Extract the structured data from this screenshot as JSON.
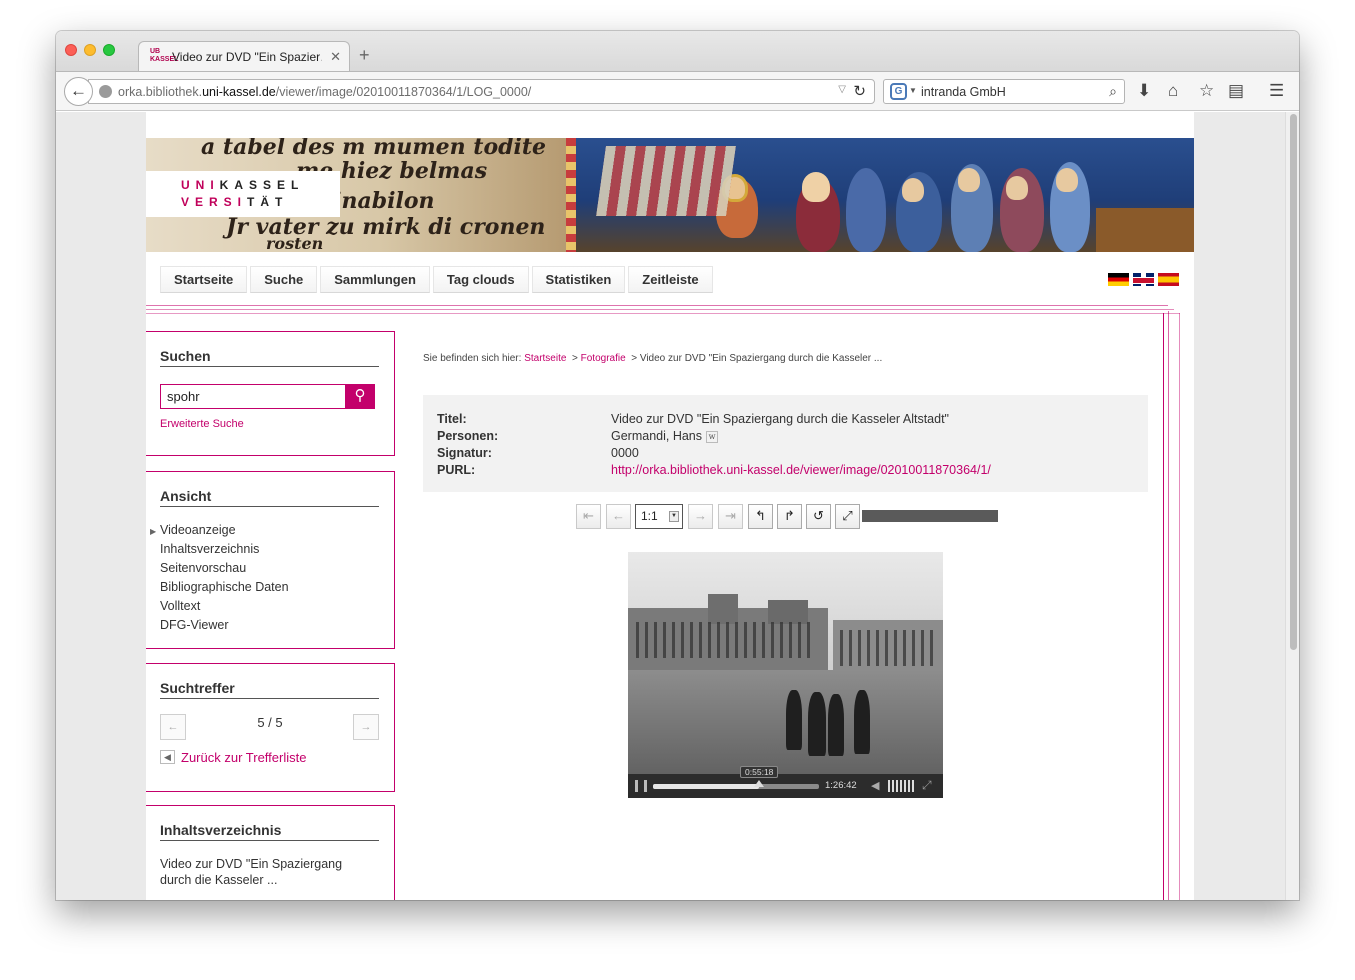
{
  "browser": {
    "tab_title": "Video zur DVD \"Ein Spazier…",
    "tab_favicon": "UB KASSEL",
    "url_prefix": "orka.bibliothek.",
    "url_domain": "uni-kassel.de",
    "url_path": "/viewer/image/02010011870364/1/LOG_0000/",
    "search_text": "intranda GmbH"
  },
  "site": {
    "logo_uni": "UNI",
    "logo_kassel": "KASSEL",
    "logo_versi": "VERSI",
    "logo_tat": "TÄT",
    "nav": [
      "Startseite",
      "Suche",
      "Sammlungen",
      "Tag clouds",
      "Statistiken",
      "Zeitleiste"
    ]
  },
  "sidebar": {
    "search_title": "Suchen",
    "search_value": "spohr",
    "advanced_link": "Erweiterte Suche",
    "view_title": "Ansicht",
    "view_items": [
      "Videoanzeige",
      "Inhaltsverzeichnis",
      "Seitenvorschau",
      "Bibliographische Daten",
      "Volltext",
      "DFG-Viewer"
    ],
    "hits_title": "Suchtreffer",
    "hits_count": "5 / 5",
    "hits_back": "Zurück zur Trefferliste",
    "toc_title": "Inhaltsverzeichnis",
    "toc_text": "Video zur DVD \"Ein Spaziergang durch die Kasseler ..."
  },
  "breadcrumb": {
    "prefix": "Sie befinden sich hier:",
    "home": "Startseite",
    "sep": ">",
    "category": "Fotografie",
    "current": "Video zur DVD \"Ein Spaziergang durch die Kasseler ..."
  },
  "metadata": {
    "title_label": "Titel:",
    "title_value": "Video zur DVD \"Ein Spaziergang durch die Kasseler Altstadt\"",
    "persons_label": "Personen:",
    "persons_value": "Germandi, Hans",
    "signature_label": "Signatur:",
    "signature_value": "0000",
    "purl_label": "PURL:",
    "purl_value": "http://orka.bibliothek.uni-kassel.de/viewer/image/02010011870364/1/"
  },
  "viewer": {
    "zoom": "1:1",
    "video_time_current": "0:55:18",
    "video_duration": "1:26:42",
    "video_progress": 0.64
  },
  "colors": {
    "accent": "#c3006b"
  }
}
